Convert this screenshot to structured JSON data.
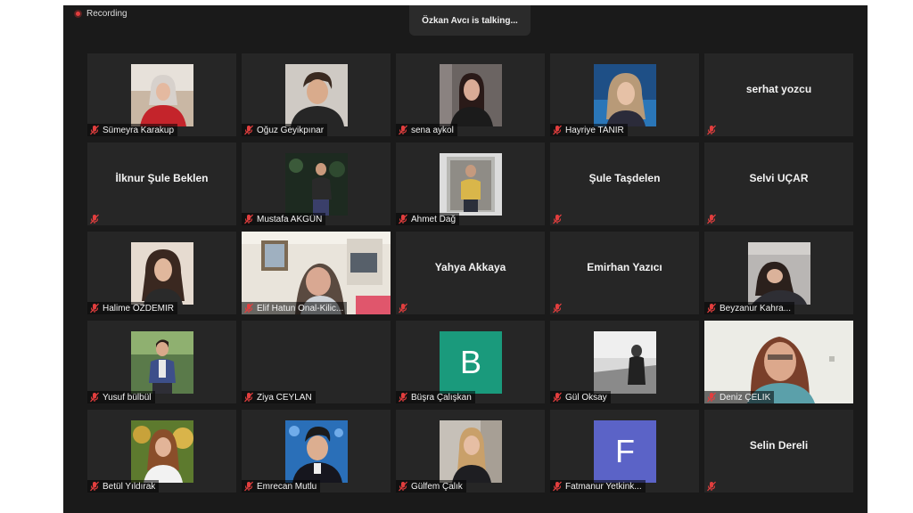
{
  "app": {
    "recording_label": "Recording",
    "talking_banner": "Özkan Avcı is talking..."
  },
  "colors": {
    "mic_muted": "#e23e3e",
    "speaker_highlight": "#f2d400",
    "avatar_b": "#1a9a7c",
    "avatar_f": "#5b63c7"
  },
  "participants": [
    {
      "name": "Sümeyra Karakup"
    },
    {
      "name": "Oğuz Geyikpınar"
    },
    {
      "name": "sena aykol"
    },
    {
      "name": "Hayriye TANIR"
    },
    {
      "name": "serhat yozcu"
    },
    {
      "name": "İlknur Şule Beklen"
    },
    {
      "name": "Mustafa AKGÜN"
    },
    {
      "name": "Ahmet Dağ"
    },
    {
      "name": "Şule Taşdelen"
    },
    {
      "name": "Selvi UÇAR"
    },
    {
      "name": "Halime ÖZDEMİR"
    },
    {
      "name": "Elif Hatun Onal-Kilic..."
    },
    {
      "name": "Yahya Akkaya"
    },
    {
      "name": "Emirhan Yazıcı"
    },
    {
      "name": "Beyzanur Kahra..."
    },
    {
      "name": "Yusuf bülbül"
    },
    {
      "name": "Ziya CEYLAN"
    },
    {
      "name": "Büşra Çalışkan",
      "avatar_letter": "B"
    },
    {
      "name": "Gül Oksay"
    },
    {
      "name": "Deniz ÇELİK"
    },
    {
      "name": "Betül Yıldırak"
    },
    {
      "name": "Emrecan Mutlu"
    },
    {
      "name": "Gülfem Çalık"
    },
    {
      "name": "Fatmanur Yetkink...",
      "avatar_letter": "F"
    },
    {
      "name": "Selin Dereli"
    }
  ]
}
